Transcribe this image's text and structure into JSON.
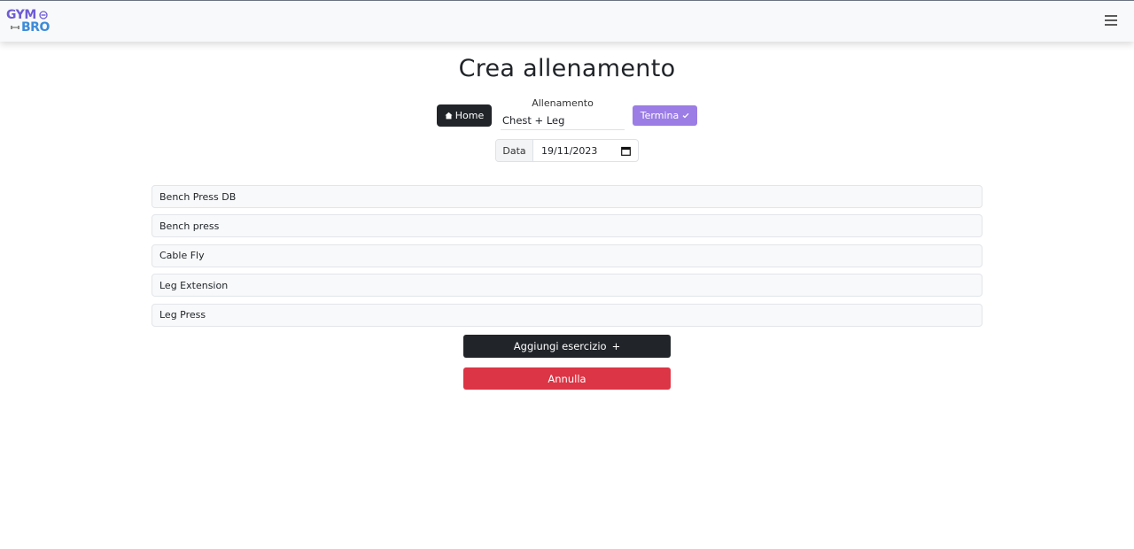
{
  "navbar": {
    "logo_top": "GYM",
    "logo_bottom": "BRO",
    "menu_icon": "hamburger-icon"
  },
  "page": {
    "title": "Crea allenamento"
  },
  "controls": {
    "home_label": "Home",
    "home_icon": "house-icon",
    "workout_label": "Allenamento",
    "workout_value": "Chest + Leg",
    "finish_label": "Termina",
    "finish_icon": "check-icon",
    "date_label": "Data",
    "date_value": "19/11/2023",
    "date_icon": "calendar-icon"
  },
  "exercises": [
    {
      "name": "Bench Press DB"
    },
    {
      "name": "Bench press"
    },
    {
      "name": "Cable Fly"
    },
    {
      "name": "Leg Extension"
    },
    {
      "name": "Leg Press"
    }
  ],
  "actions": {
    "add_label": "Aggiungi esercizio",
    "add_symbol": "+",
    "cancel_label": "Annulla"
  },
  "colors": {
    "primary_dark": "#212529",
    "accent_purple": "#9b7de5",
    "danger": "#dc3545",
    "logo_purple": "#6f5bd6",
    "logo_blue": "#3d8bd9"
  }
}
